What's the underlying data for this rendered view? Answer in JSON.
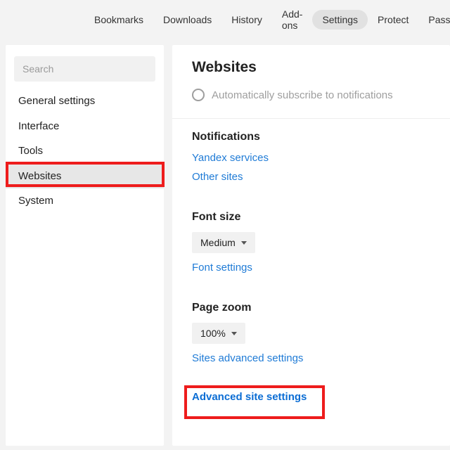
{
  "topnav": {
    "items": [
      {
        "label": "Bookmarks"
      },
      {
        "label": "Downloads"
      },
      {
        "label": "History"
      },
      {
        "label": "Add-ons"
      },
      {
        "label": "Settings"
      },
      {
        "label": "Protect"
      },
      {
        "label": "Password"
      }
    ]
  },
  "sidebar": {
    "search_placeholder": "Search",
    "items": [
      {
        "label": "General settings"
      },
      {
        "label": "Interface"
      },
      {
        "label": "Tools"
      },
      {
        "label": "Websites"
      },
      {
        "label": "System"
      }
    ]
  },
  "main": {
    "title": "Websites",
    "radio_cut": "Automatically subscribe to notifications",
    "notifications": {
      "title": "Notifications",
      "link_yandex": "Yandex services",
      "link_other": "Other sites"
    },
    "font": {
      "title": "Font size",
      "selected": "Medium",
      "settings_link": "Font settings"
    },
    "zoom": {
      "title": "Page zoom",
      "selected": "100%",
      "advanced_link": "Sites advanced settings"
    },
    "advanced_site": "Advanced site settings"
  }
}
